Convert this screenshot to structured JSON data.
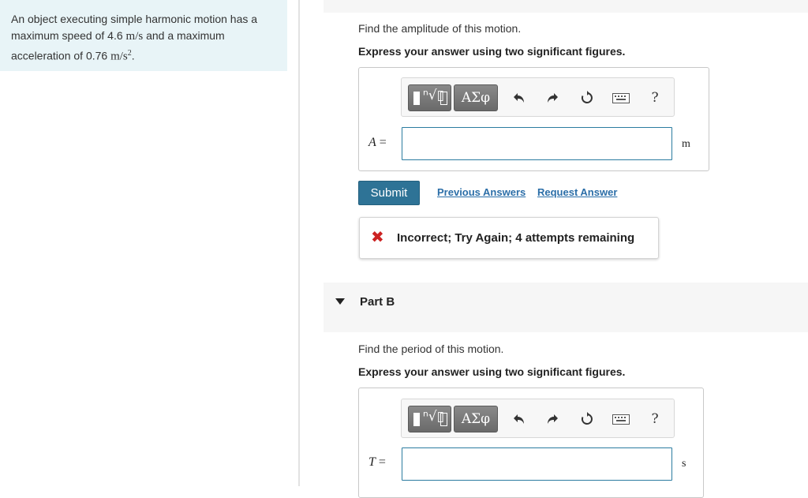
{
  "problem": {
    "line1": "An object executing simple harmonic motion has a",
    "line2_pre": "maximum speed of 4.6 ",
    "line2_unit_m": "m",
    "line2_unit_s": "/s",
    "line2_post": " and a maximum",
    "line3_pre": "acceleration of 0.76 ",
    "line3_unit": "m/s",
    "line3_exp": "2",
    "line3_post": "."
  },
  "partA": {
    "question": "Find the amplitude of this motion.",
    "instruction": "Express your answer using two significant figures.",
    "variable": "A",
    "equals": "=",
    "input_value": "",
    "unit": "m",
    "greek_label": "ΑΣφ",
    "help_label": "?",
    "submit_label": "Submit",
    "prev_answers_label": "Previous Answers",
    "request_answer_label": "Request Answer",
    "feedback_icon": "✖",
    "feedback_text": "Incorrect; Try Again; 4 attempts remaining"
  },
  "partB": {
    "title": "Part B",
    "question": "Find the period of this motion.",
    "instruction": "Express your answer using two significant figures.",
    "variable": "T",
    "equals": "=",
    "input_value": "",
    "unit": "s",
    "greek_label": "ΑΣφ",
    "help_label": "?"
  },
  "colors": {
    "accent": "#2e7396",
    "link": "#2b6ea8",
    "error": "#cc2222",
    "problem_bg": "#e8f4f7"
  }
}
